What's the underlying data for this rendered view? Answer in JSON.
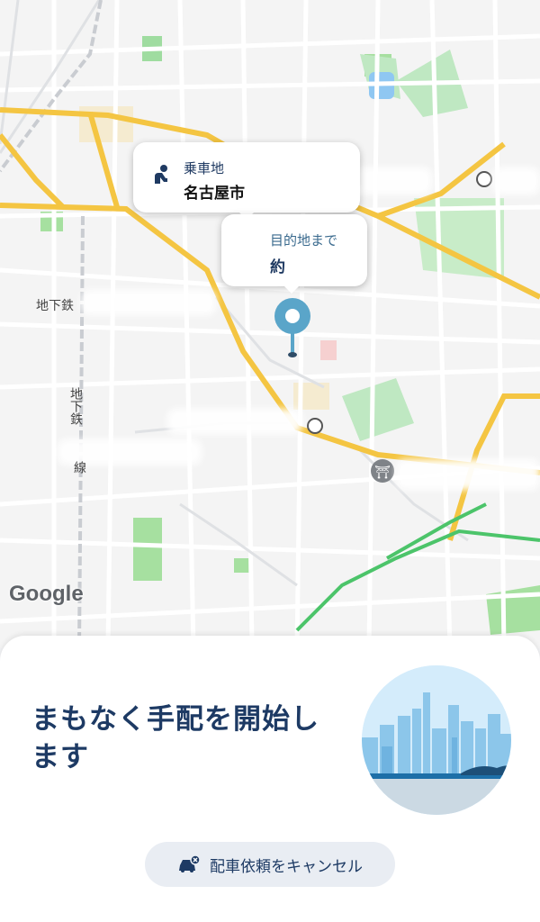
{
  "map": {
    "attribution": "Google",
    "labels": {
      "subway_1": "地下鉄",
      "subway_2": "地下鉄",
      "line_suffix": "線"
    }
  },
  "pickup": {
    "title": "乗車地",
    "place": "名古屋市",
    "icon": "passenger-seat-icon"
  },
  "eta": {
    "title": "目的地まで",
    "value": "約"
  },
  "panel": {
    "headline": "まもなく手配を開始します",
    "cancel_label": "配車依頼をキャンセル",
    "cancel_icon": "car-cancel-icon"
  },
  "colors": {
    "accent_navy": "#1d3a64",
    "destination_pin": "#5aa5c9",
    "pickup_pin": "#1f3a62"
  }
}
